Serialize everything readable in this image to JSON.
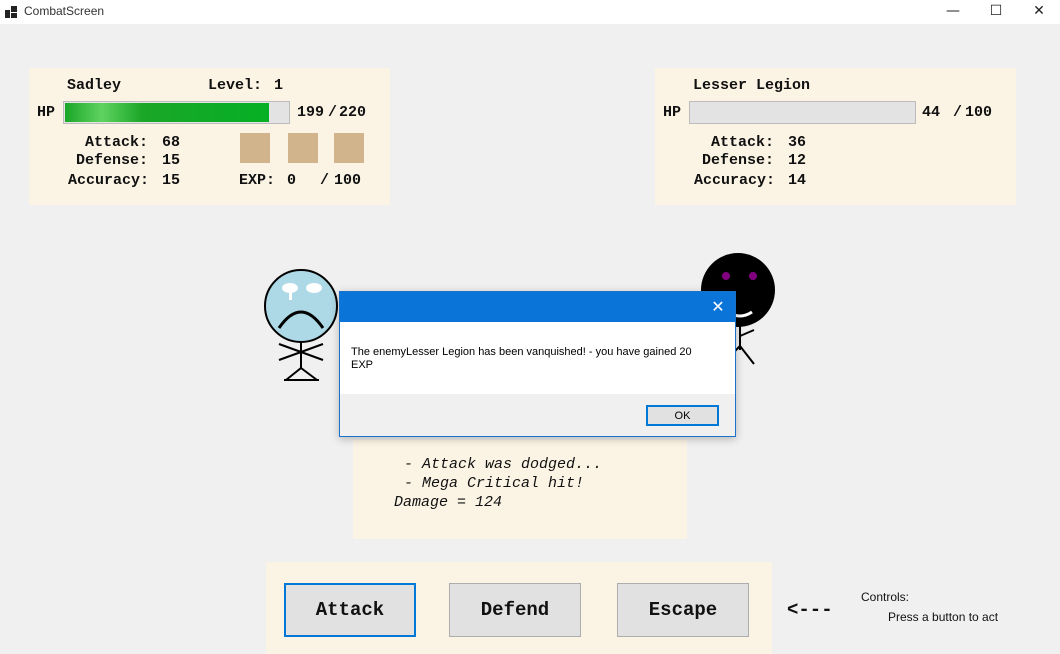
{
  "window": {
    "title": "CombatScreen",
    "minimize_glyph": "—",
    "maximize_glyph": "☐",
    "close_glyph": "✕"
  },
  "player": {
    "name": "Sadley",
    "level_label": "Level:",
    "level": "1",
    "hp_label": "HP",
    "hp_current": "199",
    "hp_sep": "/",
    "hp_max": "220",
    "hp_fraction": 0.9045,
    "attack_label": "Attack:",
    "attack": "68",
    "defense_label": "Defense:",
    "defense": "15",
    "accuracy_label": "Accuracy:",
    "accuracy": "15",
    "exp_label": "EXP:",
    "exp": "0",
    "exp_sep": "/",
    "exp_max": "100",
    "inventory_slots": 3
  },
  "enemy": {
    "name": "Lesser Legion",
    "hp_label": "HP",
    "hp_current": "44",
    "hp_sep": "/",
    "hp_max": "100",
    "hp_fraction": 0.0,
    "attack_label": "Attack:",
    "attack": "36",
    "defense_label": "Defense:",
    "defense": "12",
    "accuracy_label": "Accuracy:",
    "accuracy": "14"
  },
  "battle_log": {
    "lines": [
      " - Attack was dodged...",
      " - Mega Critical hit!",
      "Damage = 124"
    ]
  },
  "actions": {
    "attack_label": "Attack",
    "defend_label": "Defend",
    "escape_label": "Escape"
  },
  "controls": {
    "arrow": "<---",
    "title": "Controls:",
    "hint": "Press a button to act"
  },
  "dialog": {
    "message_line1": "The enemyLesser Legion has been vanquished! - you have gained 20",
    "message_line2": "EXP",
    "ok_label": "OK",
    "close_glyph": "✕"
  },
  "colors": {
    "panel": "#fbf4e5",
    "player_hp": "#06b025",
    "slot": "#d2b48c",
    "dialog_title": "#0a74d9",
    "player_face": "#add8e6",
    "enemy_face": "#000000",
    "enemy_eyes": "#800080"
  },
  "icons": {
    "app": "app-window-icon",
    "dialog_close": "close-icon"
  }
}
